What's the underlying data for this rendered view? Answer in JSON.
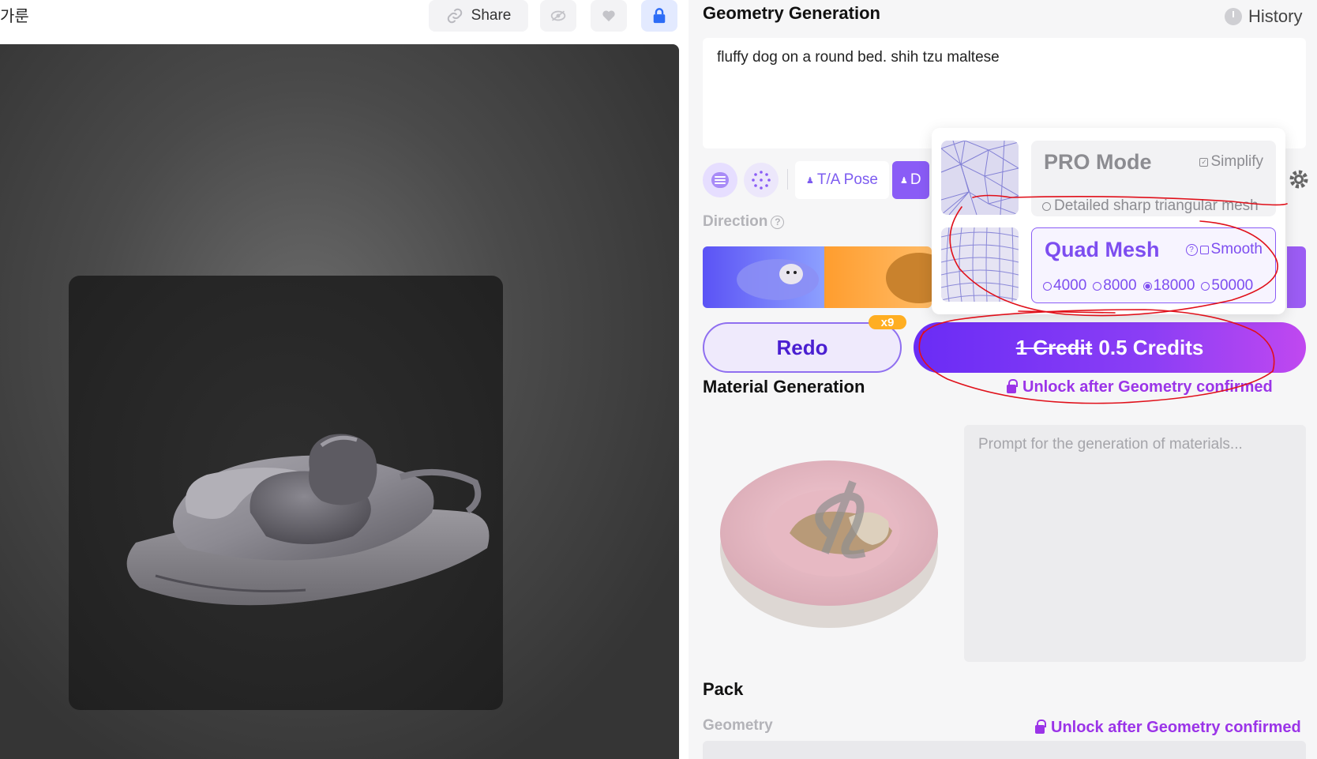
{
  "topbar": {
    "crumb": "가룬",
    "share_label": "Share",
    "share_icon": "link-icon",
    "eye_icon": "eye-off-icon",
    "heart_icon": "heart-icon",
    "lock_icon": "lock-icon"
  },
  "geometry": {
    "title": "Geometry Generation",
    "history_label": "History",
    "prompt": "fluffy dog on a round bed. shih tzu maltese",
    "chips": {
      "pose": "T/A Pose",
      "d": "D"
    },
    "direction_label": "Direction",
    "redo_label": "Redo",
    "redo_badge": "x9",
    "credit_old": "1 Credit",
    "credit_new": "0.5 Credits"
  },
  "popover": {
    "pro": {
      "name": "PRO Mode",
      "flag": "Simplify",
      "desc": "Detailed sharp triangular mesh"
    },
    "quad": {
      "name": "Quad Mesh",
      "flag": "Smooth",
      "faces": [
        "4000",
        "8000",
        "18000",
        "50000"
      ],
      "selected_face": "18000"
    }
  },
  "material": {
    "title": "Material Generation",
    "unlock": "Unlock after Geometry confirmed",
    "placeholder": "Prompt for the generation of materials..."
  },
  "pack": {
    "title": "Pack",
    "sub": "Geometry",
    "unlock": "Unlock after Geometry confirmed"
  },
  "colors": {
    "accent": "#8a5cf6",
    "credit_gradient_start": "#6a2cf5",
    "credit_gradient_end": "#c048f0",
    "unlock": "#9b34e8",
    "annotation": "#e0101a"
  }
}
